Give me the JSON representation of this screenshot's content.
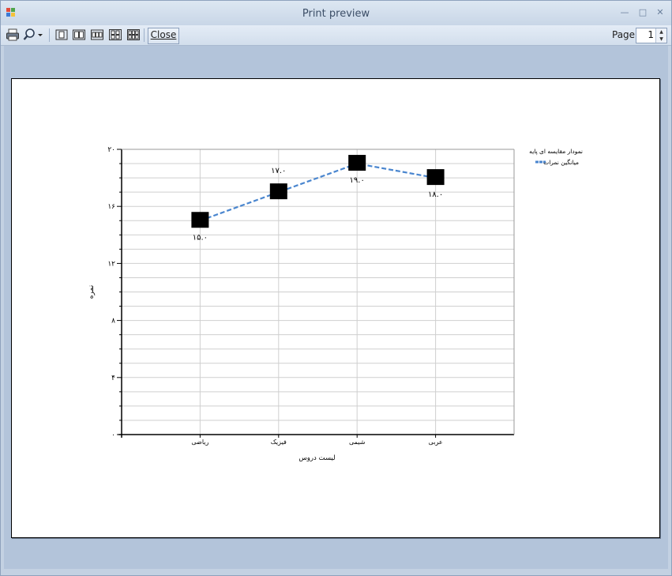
{
  "window": {
    "title": "Print preview"
  },
  "toolbar": {
    "close_label": "Close",
    "page_label": "Page",
    "page_value": "1"
  },
  "chart_data": {
    "type": "line",
    "title": "",
    "xlabel": "لیست دروس",
    "ylabel": "نمره",
    "categories": [
      "ریاضی",
      "فیزیک",
      "شیمی",
      "عربی"
    ],
    "series": [
      {
        "name": "میانگین نمرات",
        "values": [
          15,
          17,
          19,
          18
        ],
        "point_labels": [
          "۱۵.۰",
          "۱۷.۰",
          "۱۹.۰",
          "۱۸.۰"
        ],
        "color": "#4a86cf",
        "dashed": true,
        "marker": "square"
      }
    ],
    "ylim": [
      0,
      20
    ],
    "y_ticks": [
      0,
      4,
      8,
      12,
      16,
      20
    ],
    "y_tick_labels": [
      "۰",
      "۴",
      "۸",
      "۱۲",
      "۱۶",
      "۲۰"
    ],
    "grid": true,
    "legend": {
      "title": "نمودار مقایسه ای پایه",
      "position": "right"
    }
  }
}
